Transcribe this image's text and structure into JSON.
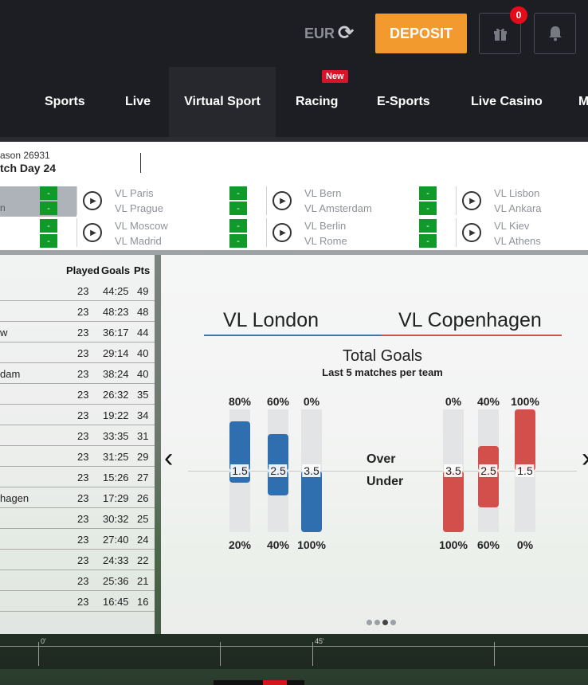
{
  "header": {
    "currency": "EUR",
    "deposit_label": "DEPOSIT",
    "gift_count": "0",
    "nav": [
      {
        "label": "Sports"
      },
      {
        "label": "Live"
      },
      {
        "label": "Virtual Sport"
      },
      {
        "label": "Racing"
      },
      {
        "label": "E-Sports"
      },
      {
        "label": "Live Casino"
      },
      {
        "label": "M"
      }
    ],
    "new_badge": "New"
  },
  "strip": {
    "season": "ason 26931",
    "match_day": "tch Day 24",
    "highlight_text": "n",
    "odd_label": "-",
    "matches": [
      {
        "home": "VL Paris",
        "away": "VL Prague"
      },
      {
        "home": "VL Bern",
        "away": "VL Amsterdam"
      },
      {
        "home": "VL Lisbon",
        "away": "VL Ankara"
      },
      {
        "home": "VL Moscow",
        "away": "VL Madrid"
      },
      {
        "home": "VL Berlin",
        "away": "VL Rome"
      },
      {
        "home": "VL Kiev",
        "away": "VL Athens"
      }
    ]
  },
  "table": {
    "headers": {
      "played": "Played",
      "goals": "Goals",
      "pts": "Pts"
    },
    "rows": [
      {
        "team": "",
        "played": "23",
        "goals": "44:25",
        "pts": "49"
      },
      {
        "team": "",
        "played": "23",
        "goals": "48:23",
        "pts": "48"
      },
      {
        "team": "w",
        "played": "23",
        "goals": "36:17",
        "pts": "44"
      },
      {
        "team": "",
        "played": "23",
        "goals": "29:14",
        "pts": "40"
      },
      {
        "team": "dam",
        "played": "23",
        "goals": "38:24",
        "pts": "40"
      },
      {
        "team": "",
        "played": "23",
        "goals": "26:32",
        "pts": "35"
      },
      {
        "team": "",
        "played": "23",
        "goals": "19:22",
        "pts": "34"
      },
      {
        "team": "",
        "played": "23",
        "goals": "33:35",
        "pts": "31"
      },
      {
        "team": "",
        "played": "23",
        "goals": "31:25",
        "pts": "29"
      },
      {
        "team": "",
        "played": "23",
        "goals": "15:26",
        "pts": "27"
      },
      {
        "team": "hagen",
        "played": "23",
        "goals": "17:29",
        "pts": "26"
      },
      {
        "team": "",
        "played": "23",
        "goals": "30:32",
        "pts": "25"
      },
      {
        "team": "",
        "played": "23",
        "goals": "27:40",
        "pts": "24"
      },
      {
        "team": "",
        "played": "23",
        "goals": "24:33",
        "pts": "22"
      },
      {
        "team": "",
        "played": "23",
        "goals": "25:36",
        "pts": "21"
      },
      {
        "team": "",
        "played": "23",
        "goals": "16:45",
        "pts": "16"
      }
    ]
  },
  "stats": {
    "home_team": "VL London",
    "away_team": "VL Copenhagen",
    "title": "Total Goals",
    "subtitle": "Last 5 matches per team",
    "over_label": "Over",
    "under_label": "Under",
    "home_color": "#2f6fb0",
    "away_color": "#d24f4b",
    "home_bars": [
      {
        "line": "1.5",
        "over": "80%",
        "under": "20%",
        "over_value": 80,
        "under_value": 20
      },
      {
        "line": "2.5",
        "over": "60%",
        "under": "40%",
        "over_value": 60,
        "under_value": 40
      },
      {
        "line": "3.5",
        "over": "0%",
        "under": "100%",
        "over_value": 0,
        "under_value": 100
      }
    ],
    "away_bars": [
      {
        "line": "3.5",
        "over": "0%",
        "under": "100%",
        "over_value": 0,
        "under_value": 100
      },
      {
        "line": "2.5",
        "over": "40%",
        "under": "60%",
        "over_value": 40,
        "under_value": 60
      },
      {
        "line": "1.5",
        "over": "100%",
        "under": "0%",
        "over_value": 100,
        "under_value": 0
      }
    ]
  },
  "timeline": {
    "start": "0'",
    "mid": "45'"
  }
}
